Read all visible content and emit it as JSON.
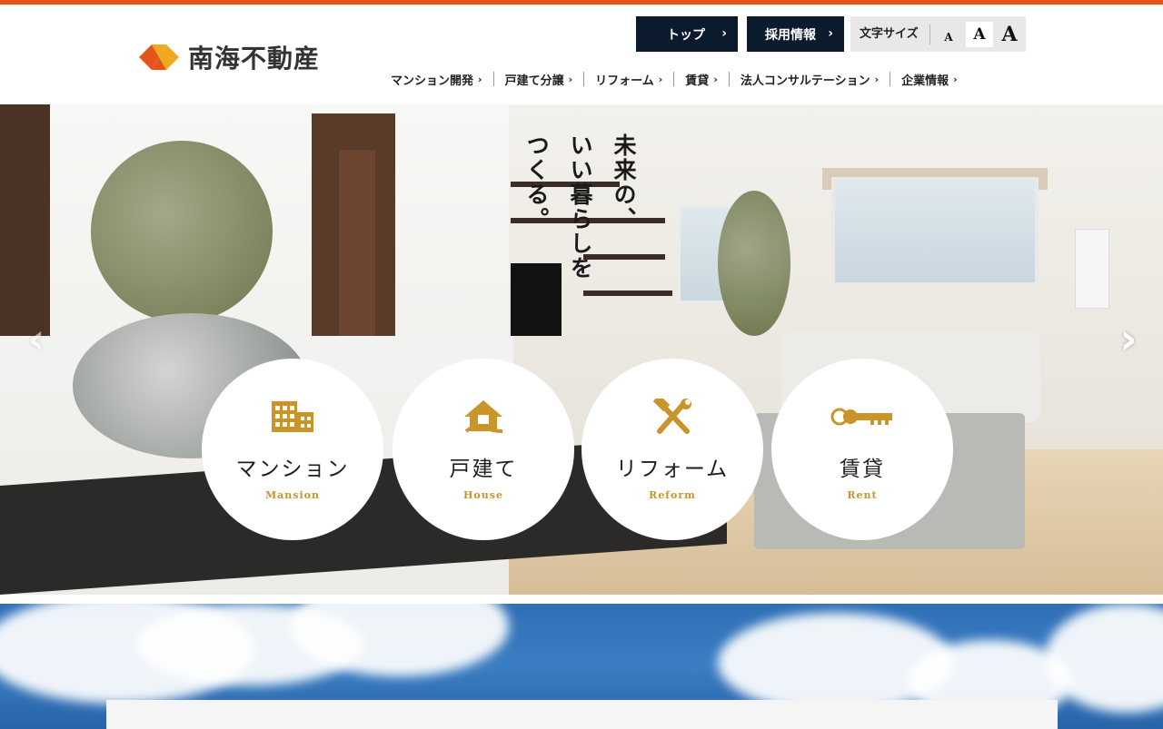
{
  "site": {
    "logo_text": "南海不動産",
    "accent_color": "#e5541b",
    "logo_colors": [
      "#e5541b",
      "#f0a81e"
    ]
  },
  "utility": {
    "top_label": "トップ",
    "recruit_label": "採用情報",
    "fontsize_label": "文字サイズ",
    "fontsize_small": "A",
    "fontsize_medium": "A",
    "fontsize_large": "A"
  },
  "nav": {
    "items": [
      {
        "label": "マンション開発"
      },
      {
        "label": "戸建て分譲"
      },
      {
        "label": "リフォーム"
      },
      {
        "label": "賃貸"
      },
      {
        "label": "法人コンサルテーション"
      },
      {
        "label": "企業情報"
      }
    ],
    "chevron": "›"
  },
  "hero": {
    "tagline_lines": [
      "未来の、",
      "いい暮らしを",
      "つくる。"
    ],
    "prev_arrow": "‹",
    "next_arrow": "›"
  },
  "categories": [
    {
      "jp": "マンション",
      "en": "Mansion",
      "icon": "building-icon"
    },
    {
      "jp": "戸建て",
      "en": "House",
      "icon": "house-icon"
    },
    {
      "jp": "リフォーム",
      "en": "Reform",
      "icon": "tools-icon"
    },
    {
      "jp": "賃貸",
      "en": "Rent",
      "icon": "key-icon"
    }
  ],
  "colors": {
    "dark_button": "#0c1a2e",
    "gold": "#c9952a"
  }
}
